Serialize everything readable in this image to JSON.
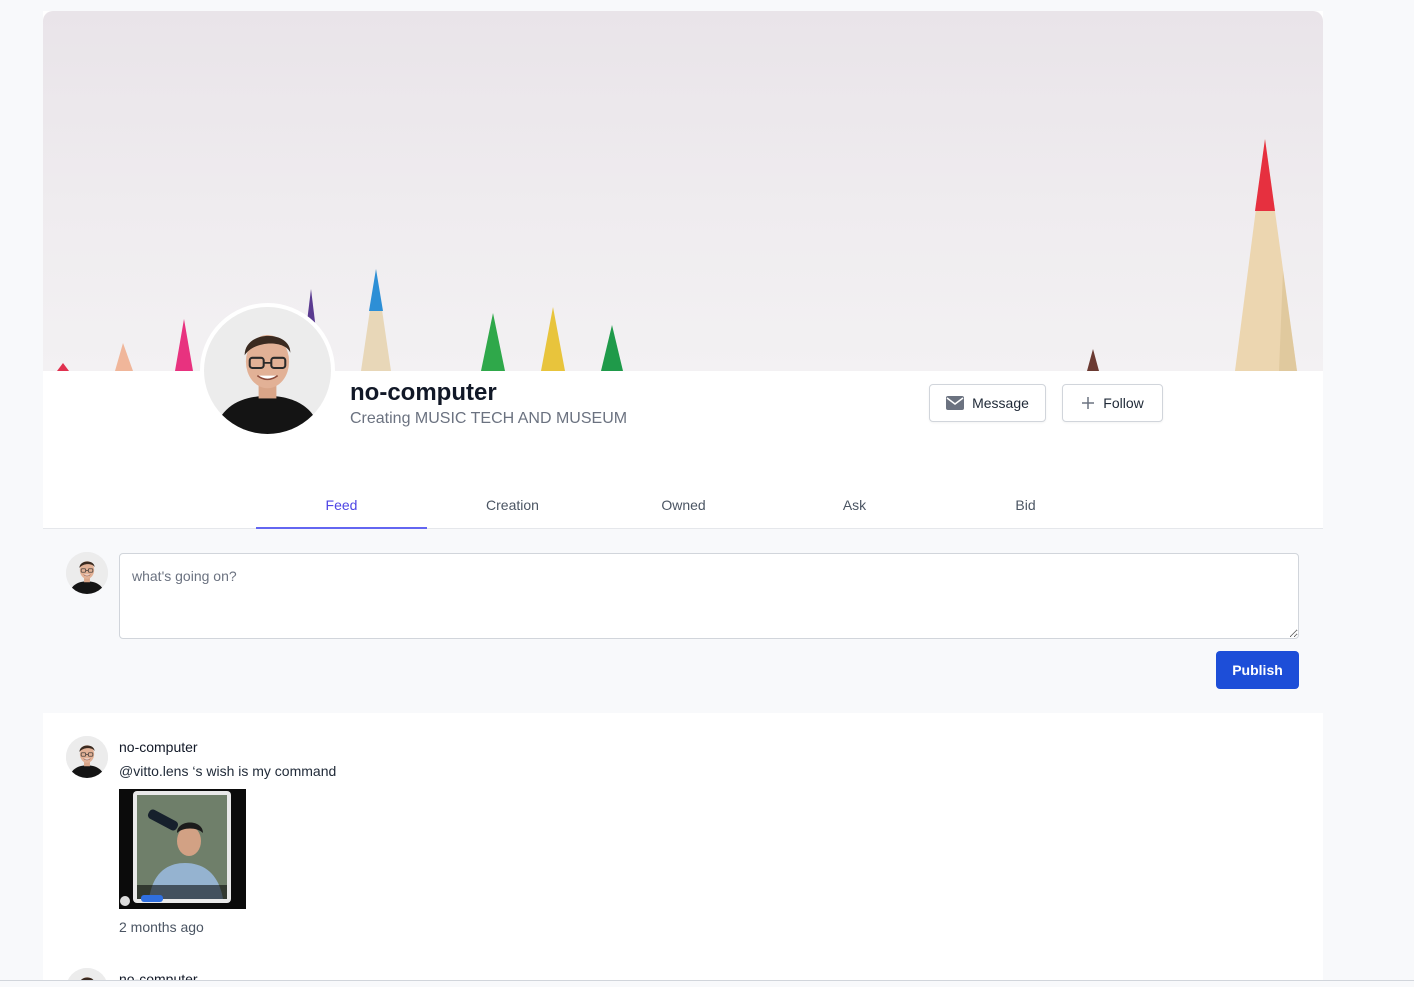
{
  "profile": {
    "name": "no-computer",
    "tagline": "Creating MUSIC TECH AND MUSEUM",
    "message_label": "Message",
    "follow_label": "Follow"
  },
  "tabs": [
    {
      "label": "Feed",
      "active": true
    },
    {
      "label": "Creation",
      "active": false
    },
    {
      "label": "Owned",
      "active": false
    },
    {
      "label": "Ask",
      "active": false
    },
    {
      "label": "Bid",
      "active": false
    }
  ],
  "compose": {
    "placeholder": "what's going on?",
    "publish_label": "Publish"
  },
  "posts": [
    {
      "author": "no-computer",
      "text": "@vitto.lens ‘s wish is my command",
      "time": "2 months ago"
    },
    {
      "author": "no-computer"
    }
  ],
  "icons": {
    "message": "envelope-icon",
    "follow": "plus-icon"
  },
  "colors": {
    "accent": "#4f46e5",
    "publish": "#1d4ed8"
  }
}
